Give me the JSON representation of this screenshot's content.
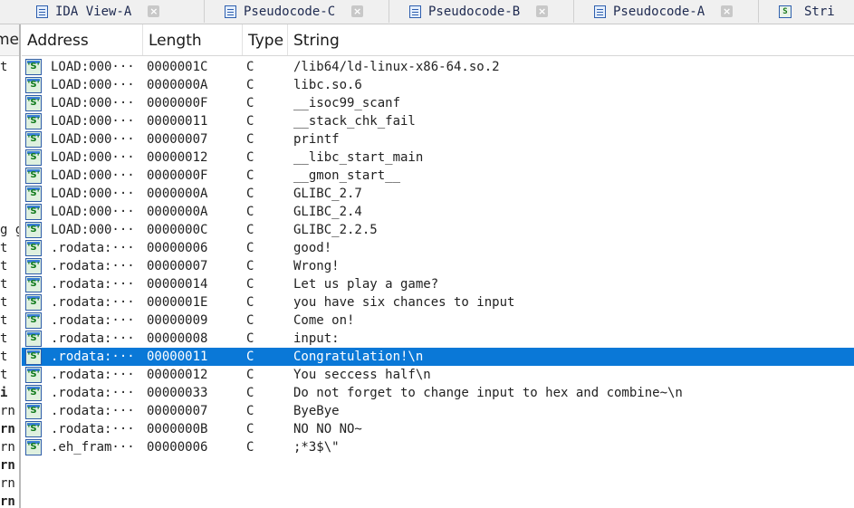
{
  "tabs": [
    {
      "label": "IDA View-A",
      "kind": "view"
    },
    {
      "label": "Pseudocode-C",
      "kind": "code"
    },
    {
      "label": "Pseudocode-B",
      "kind": "code"
    },
    {
      "label": "Pseudocode-A",
      "kind": "code"
    },
    {
      "label": "Stri",
      "kind": "strings"
    }
  ],
  "left_pane": {
    "header": "me",
    "rows": [
      "t",
      "",
      "",
      "",
      "",
      "",
      "",
      "",
      "",
      "g gc",
      "t",
      "t",
      "t",
      "t",
      "t",
      "t",
      "t",
      "t",
      "i",
      "rn",
      "rn",
      "rn",
      "rn",
      "rn",
      "rn"
    ]
  },
  "table": {
    "columns": [
      "Address",
      "Length",
      "Type",
      "String"
    ],
    "selected_index": 16,
    "rows": [
      {
        "address": "LOAD:000···",
        "length": "0000001C",
        "type": "C",
        "string": "/lib64/ld-linux-x86-64.so.2"
      },
      {
        "address": "LOAD:000···",
        "length": "0000000A",
        "type": "C",
        "string": "libc.so.6"
      },
      {
        "address": "LOAD:000···",
        "length": "0000000F",
        "type": "C",
        "string": "__isoc99_scanf"
      },
      {
        "address": "LOAD:000···",
        "length": "00000011",
        "type": "C",
        "string": "__stack_chk_fail"
      },
      {
        "address": "LOAD:000···",
        "length": "00000007",
        "type": "C",
        "string": "printf"
      },
      {
        "address": "LOAD:000···",
        "length": "00000012",
        "type": "C",
        "string": "__libc_start_main"
      },
      {
        "address": "LOAD:000···",
        "length": "0000000F",
        "type": "C",
        "string": "__gmon_start__"
      },
      {
        "address": "LOAD:000···",
        "length": "0000000A",
        "type": "C",
        "string": "GLIBC_2.7"
      },
      {
        "address": "LOAD:000···",
        "length": "0000000A",
        "type": "C",
        "string": "GLIBC_2.4"
      },
      {
        "address": "LOAD:000···",
        "length": "0000000C",
        "type": "C",
        "string": "GLIBC_2.2.5"
      },
      {
        "address": ".rodata:···",
        "length": "00000006",
        "type": "C",
        "string": "good!"
      },
      {
        "address": ".rodata:···",
        "length": "00000007",
        "type": "C",
        "string": "Wrong!"
      },
      {
        "address": ".rodata:···",
        "length": "00000014",
        "type": "C",
        "string": "Let us play a game?"
      },
      {
        "address": ".rodata:···",
        "length": "0000001E",
        "type": "C",
        "string": "you have six chances to input"
      },
      {
        "address": ".rodata:···",
        "length": "00000009",
        "type": "C",
        "string": "Come on!"
      },
      {
        "address": ".rodata:···",
        "length": "00000008",
        "type": "C",
        "string": "input:"
      },
      {
        "address": ".rodata:···",
        "length": "00000011",
        "type": "C",
        "string": "Congratulation!\\n"
      },
      {
        "address": ".rodata:···",
        "length": "00000012",
        "type": "C",
        "string": "You seccess half\\n"
      },
      {
        "address": ".rodata:···",
        "length": "00000033",
        "type": "C",
        "string": "Do not forget to change input to hex and combine~\\n"
      },
      {
        "address": ".rodata:···",
        "length": "00000007",
        "type": "C",
        "string": "ByeBye"
      },
      {
        "address": ".rodata:···",
        "length": "0000000B",
        "type": "C",
        "string": "NO NO NO~"
      },
      {
        "address": ".eh_fram···",
        "length": "00000006",
        "type": "C",
        "string": ";*3$\\\""
      }
    ]
  },
  "colors": {
    "selection": "#0a78d7",
    "string_icon_green": "#0f7a1a",
    "icon_border": "#2e5ca8"
  },
  "icons": {
    "tab_doc": "document-lines-icon",
    "tab_close": "close-icon",
    "string_row": "string-literal-icon"
  }
}
